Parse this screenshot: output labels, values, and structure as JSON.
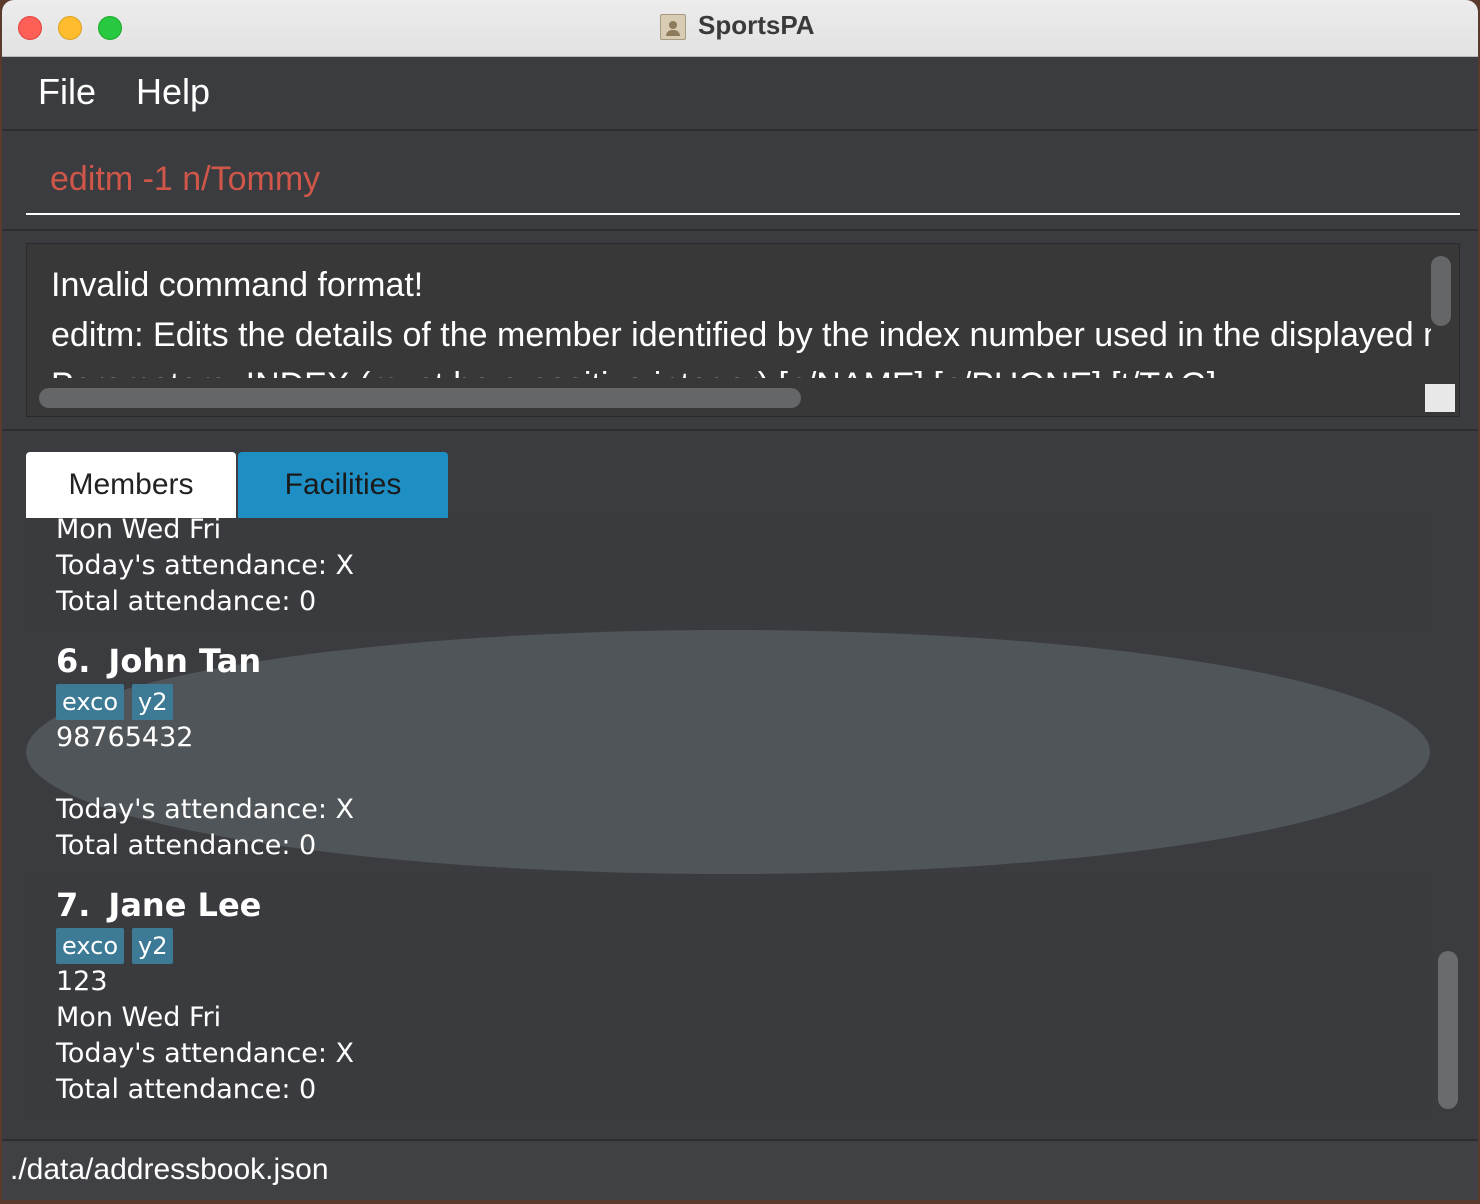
{
  "window": {
    "title": "SportsPA",
    "app_icon": "address-book-icon"
  },
  "menu": {
    "items": [
      "File",
      "Help"
    ]
  },
  "command_box": {
    "value": "editm -1 n/Tommy",
    "text_color": "#d1564a"
  },
  "result_display": {
    "lines": [
      "Invalid command format!",
      "editm: Edits the details of the member identified by the index number used in the displayed member list.",
      "Parameters: INDEX (must be a positive integer) [n/NAME] [p/PHONE] [t/TAG]..."
    ]
  },
  "tabs": [
    {
      "label": "Members",
      "selected": true
    },
    {
      "label": "Facilities",
      "selected": false
    }
  ],
  "member_list": {
    "partial_card": {
      "days": "Mon Wed Fri",
      "today_attendance": "Today's attendance: X",
      "total_attendance": "Total attendance: 0"
    },
    "cards": [
      {
        "index": "6.",
        "name": "John Tan",
        "tags": [
          "exco",
          "y2"
        ],
        "phone": "98765432",
        "days": "",
        "today_attendance": "Today's attendance: X",
        "total_attendance": "Total attendance: 0",
        "selected": true
      },
      {
        "index": "7.",
        "name": "Jane Lee",
        "tags": [
          "exco",
          "y2"
        ],
        "phone": "123",
        "days": "Mon Wed Fri",
        "today_attendance": "Today's attendance: X",
        "total_attendance": "Total attendance: 0",
        "selected": false
      }
    ]
  },
  "status_bar": {
    "file_path": "./data/addressbook.json"
  },
  "colors": {
    "background": "#3b3c3f",
    "selected_card": "#4f5558",
    "tag": "#3d7a96",
    "facilities_tab": "#1e8fc4"
  }
}
